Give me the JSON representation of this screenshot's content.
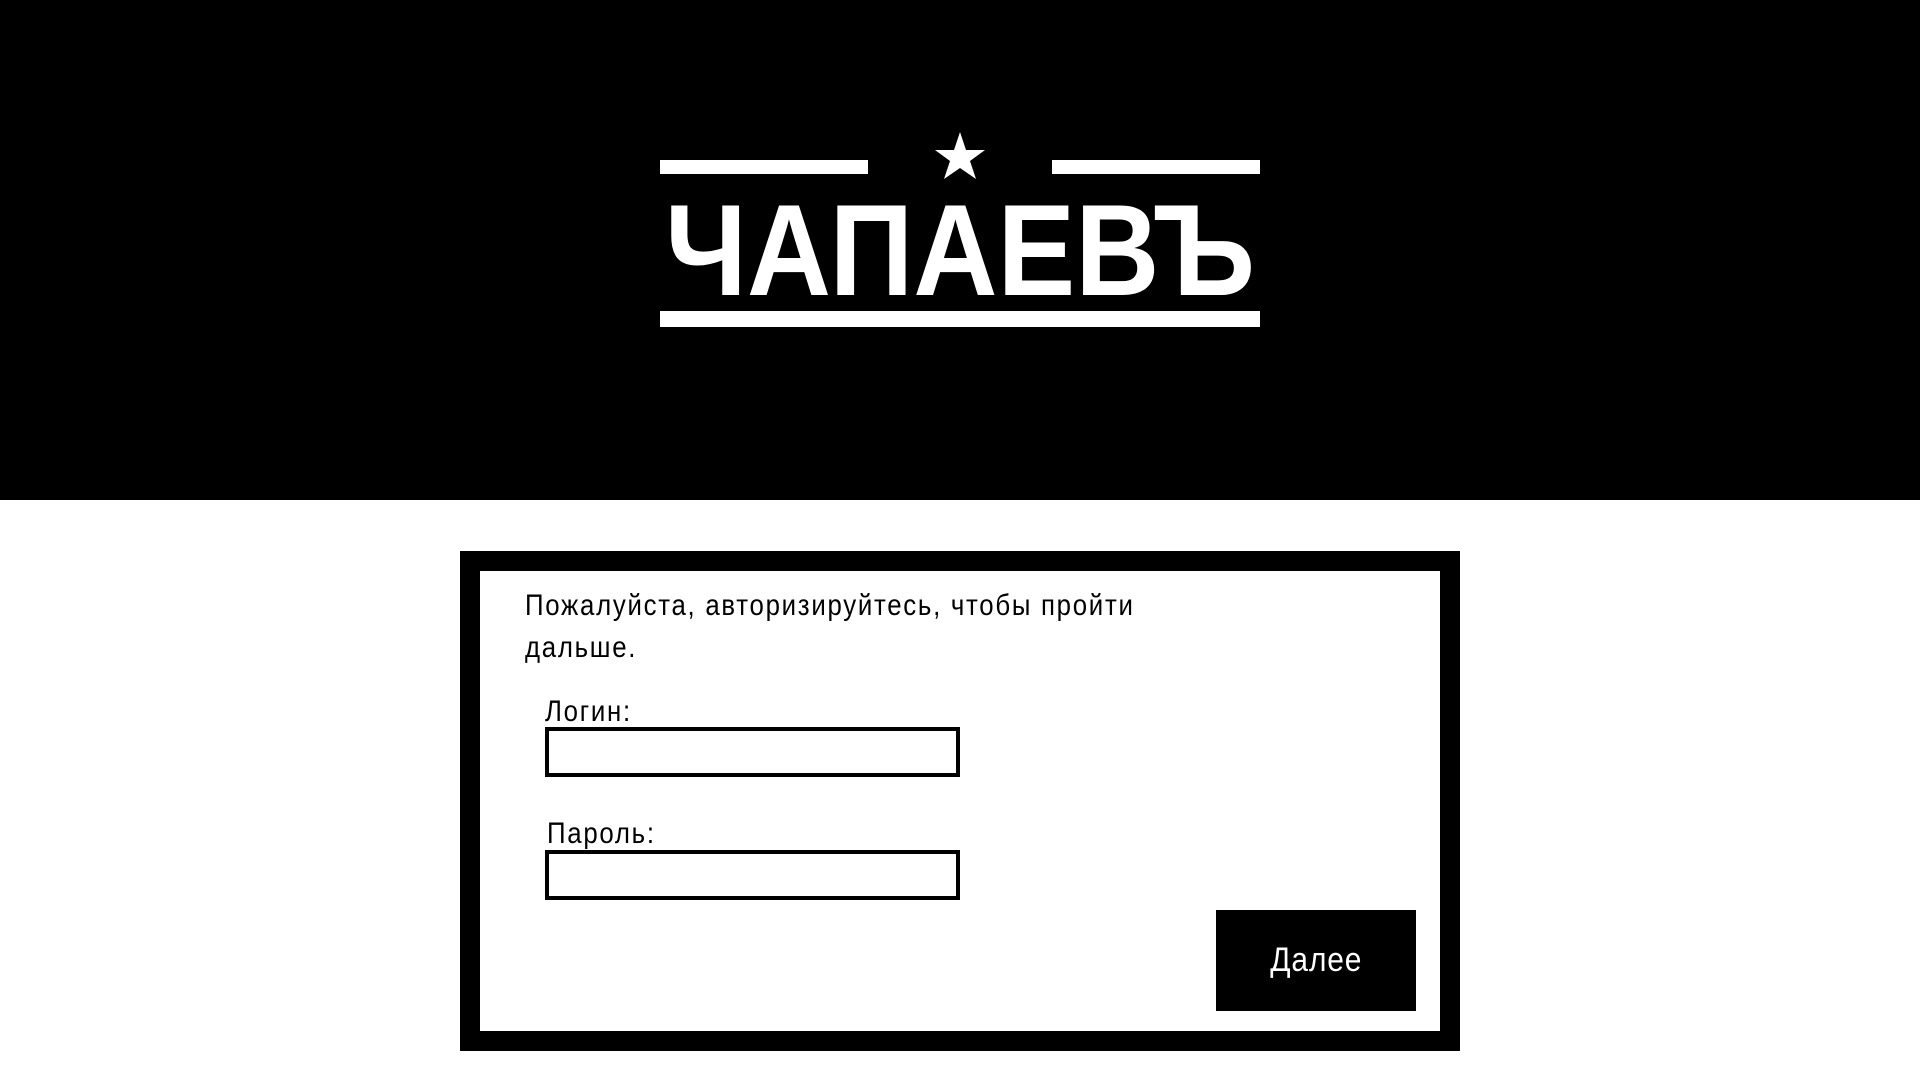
{
  "brand": {
    "logo_text": "ЧАПАЕВЪ",
    "logo_star": "★"
  },
  "auth": {
    "prompt": "Пожалуйста, авторизируйтесь, чтобы пройти дальше.",
    "login_label": "Логин:",
    "login_value": "",
    "password_label": "Пароль:",
    "password_value": "",
    "submit_label": "Далее"
  },
  "colors": {
    "background": "#ffffff",
    "header": "#000000",
    "accent": "#000000",
    "text": "#000000"
  }
}
